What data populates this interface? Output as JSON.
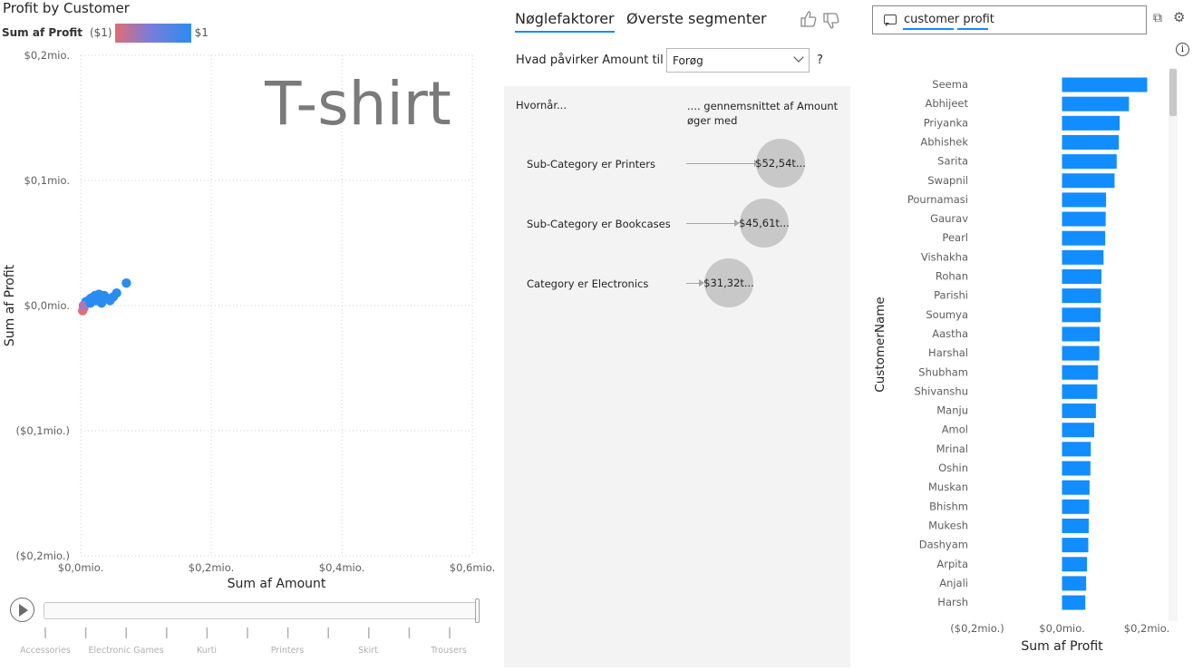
{
  "scatter": {
    "title": "Profit by Customer",
    "legend": {
      "title": "Sum af Profit",
      "min_label": "($1)",
      "max_label": "$1",
      "color_low": "#e06c75",
      "color_high": "#2b8cf0"
    },
    "watermark": "T-shirt",
    "y_label": "Sum af Profit",
    "x_label": "Sum af Amount"
  },
  "play_axis": {
    "labels": [
      "Accessories",
      "Electronic Games",
      "Kurti",
      "Printers",
      "Skirt",
      "Trousers"
    ]
  },
  "key_influencers": {
    "tabs": [
      "Nøglefaktorer",
      "Øverste segmenter"
    ],
    "question": "Hvad påvirker Amount til",
    "dropdown_value": "Forøg",
    "help": "?",
    "col_when": "Hvornår...",
    "col_avg": ".... gennemsnittet af Amount øger med",
    "factors": [
      {
        "label": "Sub-Category er Printers",
        "value": "$52,54t..."
      },
      {
        "label": "Sub-Category er Bookcases",
        "value": "$45,61t..."
      },
      {
        "label": "Category er Electronics",
        "value": "$31,32t..."
      }
    ]
  },
  "qa": {
    "query": "customer profit",
    "info": "i"
  },
  "chart_data": [
    {
      "type": "scatter",
      "title": "Profit by Customer",
      "xlabel": "Sum af Amount",
      "ylabel": "Sum af Profit",
      "xlim": [
        0,
        0.6
      ],
      "ylim": [
        -0.2,
        0.2
      ],
      "x_ticks": [
        "$0,0mio.",
        "$0,2mio.",
        "$0,4mio.",
        "$0,6mio."
      ],
      "y_ticks": [
        "$0,2mio.",
        "$0,1mio.",
        "$0,0mio.",
        "($0,1mio.)",
        "($0,2mio.)"
      ],
      "x_tick_values": [
        0,
        0.2,
        0.4,
        0.6
      ],
      "y_tick_values": [
        0.2,
        0.1,
        0,
        -0.1,
        -0.2
      ],
      "grid": true,
      "points": [
        {
          "x": 0.003,
          "y": -0.004,
          "c": "#e06c75"
        },
        {
          "x": 0.005,
          "y": -0.002,
          "c": "#d87088"
        },
        {
          "x": 0.006,
          "y": 0.001,
          "c": "#8a7fd8"
        },
        {
          "x": 0.008,
          "y": 0.003,
          "c": "#2b8cf0"
        },
        {
          "x": 0.01,
          "y": 0.002,
          "c": "#2b8cf0"
        },
        {
          "x": 0.012,
          "y": 0.004,
          "c": "#2b8cf0"
        },
        {
          "x": 0.014,
          "y": 0.005,
          "c": "#2b8cf0"
        },
        {
          "x": 0.016,
          "y": 0.006,
          "c": "#2b8cf0"
        },
        {
          "x": 0.018,
          "y": 0.005,
          "c": "#2b8cf0"
        },
        {
          "x": 0.02,
          "y": 0.007,
          "c": "#2b8cf0"
        },
        {
          "x": 0.022,
          "y": 0.008,
          "c": "#2b8cf0"
        },
        {
          "x": 0.024,
          "y": 0.004,
          "c": "#2b8cf0"
        },
        {
          "x": 0.026,
          "y": 0.006,
          "c": "#2b8cf0"
        },
        {
          "x": 0.028,
          "y": 0.009,
          "c": "#2b8cf0"
        },
        {
          "x": 0.03,
          "y": 0.006,
          "c": "#2b8cf0"
        },
        {
          "x": 0.033,
          "y": 0.005,
          "c": "#2b8cf0"
        },
        {
          "x": 0.036,
          "y": 0.008,
          "c": "#2b8cf0"
        },
        {
          "x": 0.04,
          "y": 0.006,
          "c": "#2b8cf0"
        },
        {
          "x": 0.045,
          "y": 0.004,
          "c": "#2b8cf0"
        },
        {
          "x": 0.05,
          "y": 0.007,
          "c": "#2b8cf0"
        },
        {
          "x": 0.055,
          "y": 0.01,
          "c": "#2b8cf0"
        },
        {
          "x": 0.07,
          "y": 0.018,
          "c": "#2b8cf0"
        },
        {
          "x": 0.004,
          "y": 0.0,
          "c": "#a878b8"
        },
        {
          "x": 0.015,
          "y": 0.002,
          "c": "#2b8cf0"
        },
        {
          "x": 0.032,
          "y": 0.002,
          "c": "#2b8cf0"
        }
      ]
    },
    {
      "type": "bar",
      "orientation": "horizontal",
      "xlabel": "Sum af Profit",
      "ylabel": "CustomerName",
      "xlim": [
        -0.2,
        0.2
      ],
      "x_ticks": [
        "($0,2mio.)",
        "$0,0mio.",
        "$0,2mio."
      ],
      "x_tick_values": [
        -0.2,
        0,
        0.2
      ],
      "color": "#118dff",
      "categories": [
        "Seema",
        "Abhijeet",
        "Priyanka",
        "Abhishek",
        "Sarita",
        "Swapnil",
        "Pournamasi",
        "Gaurav",
        "Pearl",
        "Vishakha",
        "Rohan",
        "Parishi",
        "Soumya",
        "Aastha",
        "Harshal",
        "Shubham",
        "Shivanshu",
        "Manju",
        "Amol",
        "Mrinal",
        "Oshin",
        "Muskan",
        "Bhishm",
        "Mukesh",
        "Dashyam",
        "Arpita",
        "Anjali",
        "Harsh"
      ],
      "values": [
        0.201,
        0.158,
        0.136,
        0.134,
        0.129,
        0.124,
        0.104,
        0.103,
        0.102,
        0.098,
        0.093,
        0.092,
        0.091,
        0.089,
        0.088,
        0.085,
        0.083,
        0.08,
        0.076,
        0.068,
        0.067,
        0.065,
        0.064,
        0.063,
        0.062,
        0.059,
        0.057,
        0.055
      ]
    }
  ]
}
